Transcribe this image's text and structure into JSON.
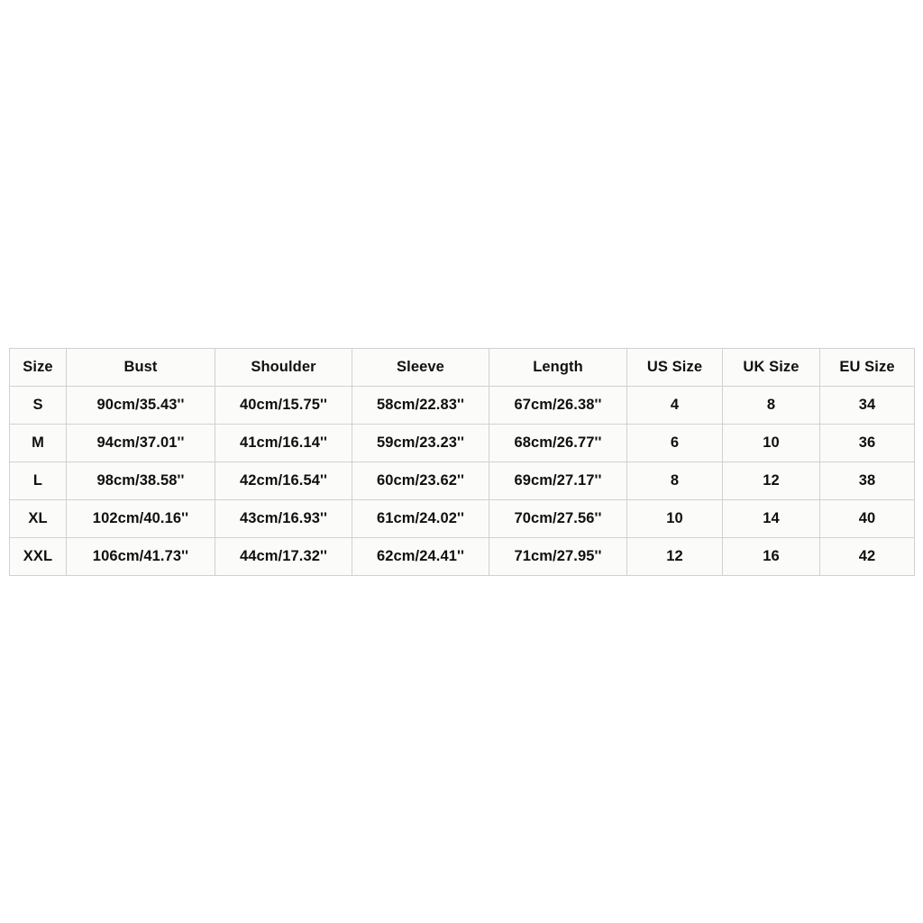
{
  "table": {
    "columns": [
      "Size",
      "Bust",
      "Shoulder",
      "Sleeve",
      "Length",
      "US Size",
      "UK Size",
      "EU Size"
    ],
    "rows": [
      {
        "size": "S",
        "bust": "90cm/35.43''",
        "shoulder": "40cm/15.75''",
        "sleeve": "58cm/22.83''",
        "length": "67cm/26.38''",
        "us": "4",
        "uk": "8",
        "eu": "34"
      },
      {
        "size": "M",
        "bust": "94cm/37.01''",
        "shoulder": "41cm/16.14''",
        "sleeve": "59cm/23.23''",
        "length": "68cm/26.77''",
        "us": "6",
        "uk": "10",
        "eu": "36"
      },
      {
        "size": "L",
        "bust": "98cm/38.58''",
        "shoulder": "42cm/16.54''",
        "sleeve": "60cm/23.62''",
        "length": "69cm/27.17''",
        "us": "8",
        "uk": "12",
        "eu": "38"
      },
      {
        "size": "XL",
        "bust": "102cm/40.16''",
        "shoulder": "43cm/16.93''",
        "sleeve": "61cm/24.02''",
        "length": "70cm/27.56''",
        "us": "10",
        "uk": "14",
        "eu": "40"
      },
      {
        "size": "XXL",
        "bust": "106cm/41.73''",
        "shoulder": "44cm/17.32''",
        "sleeve": "62cm/24.41''",
        "length": "71cm/27.95''",
        "us": "12",
        "uk": "16",
        "eu": "42"
      }
    ]
  },
  "colors": {
    "page_background": "#ffffff",
    "cell_background": "#fbfcfa",
    "gridline": "#cfd2d1",
    "text": "#101010"
  }
}
